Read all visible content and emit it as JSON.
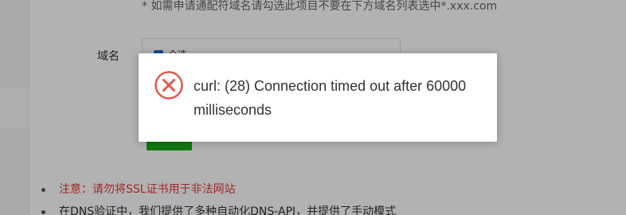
{
  "form": {
    "hint": "* 如需申请通配符域名请勾选此项目不要在下方域名列表选中*.xxx.com",
    "domain_label": "域名",
    "checkbox_label": "全选"
  },
  "notes": [
    {
      "text": "注意：请勿将SSL证书用于非法网站",
      "type": "warning"
    },
    {
      "text": "在DNS验证中，我们提供了多种自动化DNS-API，并提供了手动模式",
      "type": "info"
    }
  ],
  "dialog": {
    "icon": "error-circle-icon",
    "message": "curl: (28) Connection timed out after 60000 milliseconds",
    "icon_color": "#e4584b"
  },
  "colors": {
    "submit_button": "#1aad19",
    "warning_text": "#e53935"
  }
}
